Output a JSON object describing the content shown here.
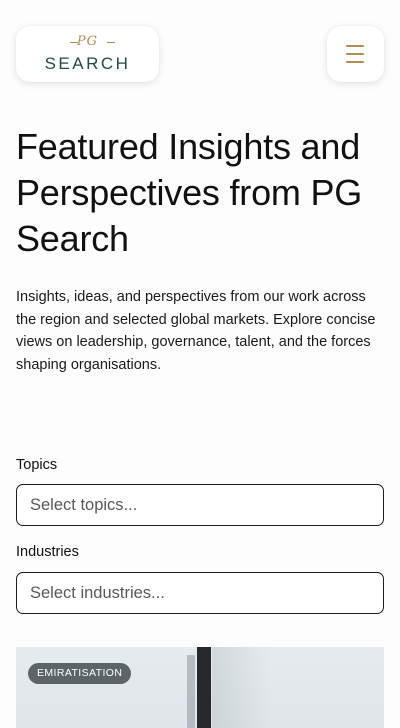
{
  "header": {
    "logo_monogram": "PG",
    "logo_wordmark": "SEARCH",
    "menu_icon": "hamburger-menu-icon"
  },
  "hero": {
    "title": "Featured Insights and Perspectives from PG Search",
    "intro": "Insights, ideas, and perspectives from our work across the region and selected global markets. Explore concise views on leadership, governance, talent, and the forces shaping organisations."
  },
  "filters": {
    "topics_label": "Topics",
    "topics_placeholder": "Select topics...",
    "industries_label": "Industries",
    "industries_placeholder": "Select industries..."
  },
  "articles": [
    {
      "badge": "EMIRATISATION"
    }
  ],
  "colors": {
    "accent_gold": "#b58a55",
    "logo_teal": "#26494a",
    "badge_bg": "#5d6468"
  }
}
